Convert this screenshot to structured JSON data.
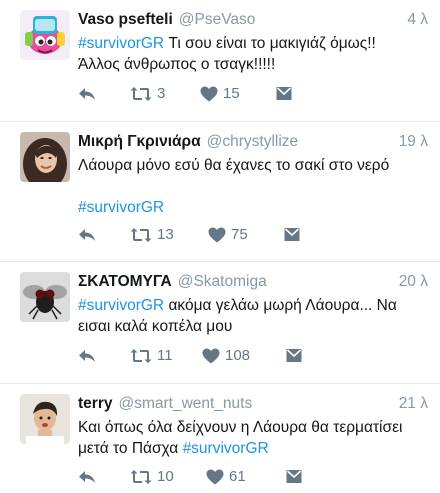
{
  "tweets": [
    {
      "name": "Vaso psefteli",
      "handle": "@PseVaso",
      "time": "4 λ",
      "lines": [
        [
          {
            "t": "#survivorGR",
            "tag": true
          },
          {
            "t": " Τι σου είναι το μακιγιάζ όμως!!"
          }
        ],
        [
          {
            "t": "Άλλος άνθρωπος ο τσαγκ!!!!!"
          }
        ]
      ],
      "retweets": "3",
      "likes": "15"
    },
    {
      "name": "Μικρή Γκρινιάρα",
      "handle": "@chrystyllize",
      "time": "19 λ",
      "lines": [
        [
          {
            "t": "Λάουρα μόνο εσύ θα έχανες το σακί στο νερό"
          }
        ],
        [],
        [
          {
            "t": "#survivorGR",
            "tag": true
          }
        ]
      ],
      "retweets": "13",
      "likes": "75"
    },
    {
      "name": "ΣΚΑΤΟΜΥΓΑ",
      "handle": "@Skatomiga",
      "time": "20 λ",
      "lines": [
        [
          {
            "t": "#survivorGR",
            "tag": true
          },
          {
            "t": " ακόμα γελάω μωρή Λάουρα... Να"
          }
        ],
        [
          {
            "t": "εισαι καλά κοπέλα μου"
          }
        ]
      ],
      "retweets": "11",
      "likes": "108"
    },
    {
      "name": "terry",
      "handle": "@smart_went_nuts",
      "time": "21 λ",
      "lines": [
        [
          {
            "t": "Και όπως όλα δείχνουν η Λάουρα θα τερματίσει"
          }
        ],
        [
          {
            "t": "μετά το Πάσχα "
          },
          {
            "t": "#survivorGR",
            "tag": true
          }
        ]
      ],
      "retweets": "10",
      "likes": "61"
    }
  ],
  "icons": {
    "reply": "reply-icon",
    "retweet": "retweet-icon",
    "like": "heart-icon",
    "dm": "direct-message-icon"
  },
  "colors": {
    "hashtag": "#1b95e0",
    "meta": "#8899a6",
    "action": "#657786",
    "divider": "#e1e8ed"
  }
}
